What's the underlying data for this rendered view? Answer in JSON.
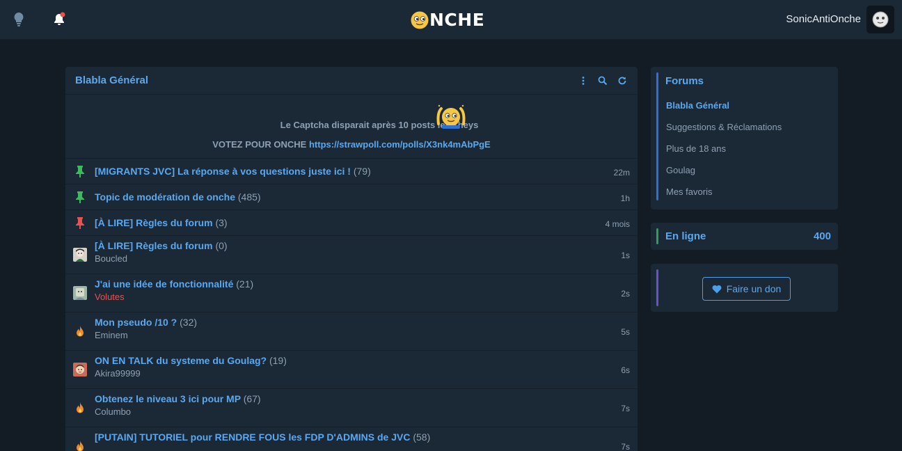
{
  "header": {
    "logo_text": "NCHE",
    "username": "SonicAntiOnche",
    "icons": [
      "lightbulb-icon",
      "bell-icon",
      "avatar"
    ]
  },
  "forum": {
    "title": "Blabla Général",
    "actions": [
      "more-icon",
      "search-icon",
      "refresh-icon"
    ],
    "announcement": {
      "captcha_text": "Le Captcha disparait après 10 posts les kheys",
      "vote_text": "VOTEZ POUR ONCHE",
      "vote_link": "https://strawpoll.com/polls/X3nk4mAbPgE"
    },
    "topics": [
      {
        "icon": "pin-green-icon",
        "title": "[MIGRANTS JVC] La réponse à vos questions juste ici !",
        "count": "(79)",
        "author": "",
        "time": "22m"
      },
      {
        "icon": "pin-green-icon",
        "title": "Topic de modération de onche",
        "count": "(485)",
        "author": "",
        "time": "1h"
      },
      {
        "icon": "pin-red-icon",
        "title": "[À LIRE] Règles du forum",
        "count": "(3)",
        "author": "",
        "time": "4 mois"
      },
      {
        "icon": "user-avatar-icon",
        "title": "[À LIRE] Règles du forum",
        "count": "(0)",
        "author": "Boucled",
        "time": "1s"
      },
      {
        "icon": "user-avatar-icon",
        "title": "J'ai une idée de fonctionnalité",
        "count": "(21)",
        "author": "Volutes",
        "time": "2s"
      },
      {
        "icon": "fire-icon",
        "title": "Mon pseudo /10 ?",
        "count": "(32)",
        "author": "Eminem",
        "time": "5s"
      },
      {
        "icon": "user-avatar-icon",
        "title": "ON EN TALK du systeme du Goulag?",
        "count": "(19)",
        "author": "Akira99999",
        "time": "6s"
      },
      {
        "icon": "fire-icon",
        "title": "Obtenez le niveau 3 ici pour MP",
        "count": "(67)",
        "author": "Columbo",
        "time": "7s"
      },
      {
        "icon": "fire-icon",
        "title": "[PUTAIN] TUTORIEL pour RENDRE FOUS les FDP D'ADMINS de JVC",
        "count": "(58)",
        "author": "",
        "time": "7s"
      }
    ]
  },
  "sidebar": {
    "forums_title": "Forums",
    "forums": [
      {
        "label": "Blabla Général",
        "active": true
      },
      {
        "label": "Suggestions & Réclamations",
        "active": false
      },
      {
        "label": "Plus de 18 ans",
        "active": false
      },
      {
        "label": "Goulag",
        "active": false
      },
      {
        "label": "Mes favoris",
        "active": false
      }
    ],
    "online_label": "En ligne",
    "online_count": "400",
    "donate_label": "Faire un don"
  },
  "colors": {
    "background": "#131b24",
    "panel": "#1b2836",
    "accent_blue": "#5aa9f0",
    "muted_text": "#8ea1b3",
    "alert_red": "#e9534f",
    "pin_green": "#3dbb5c"
  }
}
